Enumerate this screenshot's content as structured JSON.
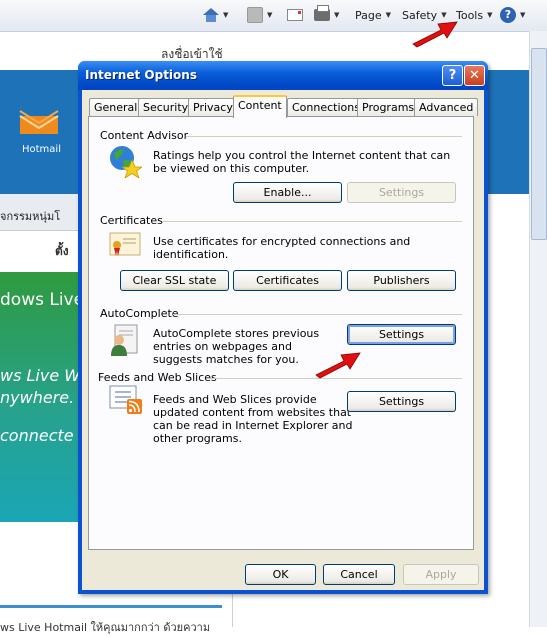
{
  "commandbar": {
    "page_label": "Page",
    "safety_label": "Safety",
    "tools_label": "Tools",
    "icons": [
      "home-icon",
      "feeds-icon",
      "read-mail-icon",
      "print-icon",
      "help-icon"
    ]
  },
  "background": {
    "signin_text": "ลงชื่อเข้าใช้",
    "hotmail_label": "Hotmail",
    "activities_text": "จกรรมหนุ่มโ",
    "set_text": "ตั้ง",
    "promo_line1": "dows Live",
    "promo_line2": "ws Live W",
    "promo_line3": "nywhere.",
    "promo_line4": "connecte",
    "bottom_text": "ws Live Hotmail ให้คุณมากกว่า ด้วยความ"
  },
  "dialog": {
    "title": "Internet Options",
    "tabs": [
      {
        "label": "General"
      },
      {
        "label": "Security"
      },
      {
        "label": "Privacy"
      },
      {
        "label": "Content"
      },
      {
        "label": "Connections"
      },
      {
        "label": "Programs"
      },
      {
        "label": "Advanced"
      }
    ],
    "active_tab": "Content",
    "content_advisor": {
      "title": "Content Advisor",
      "description": "Ratings help you control the Internet content that can be viewed on this computer.",
      "enable_label": "Enable...",
      "settings_label": "Settings"
    },
    "certificates": {
      "title": "Certificates",
      "description": "Use certificates for encrypted connections and identification.",
      "clear_ssl_label": "Clear SSL state",
      "certificates_label": "Certificates",
      "publishers_label": "Publishers"
    },
    "autocomplete": {
      "title": "AutoComplete",
      "description": "AutoComplete stores previous entries on webpages and suggests matches for you.",
      "settings_label": "Settings"
    },
    "feeds": {
      "title": "Feeds and Web Slices",
      "description": "Feeds and Web Slices provide updated content from websites that can be read in Internet Explorer and other programs.",
      "settings_label": "Settings"
    },
    "footer": {
      "ok_label": "OK",
      "cancel_label": "Cancel",
      "apply_label": "Apply"
    }
  },
  "colors": {
    "title_blue": "#0a52d0",
    "arrow_red": "#e01010"
  }
}
